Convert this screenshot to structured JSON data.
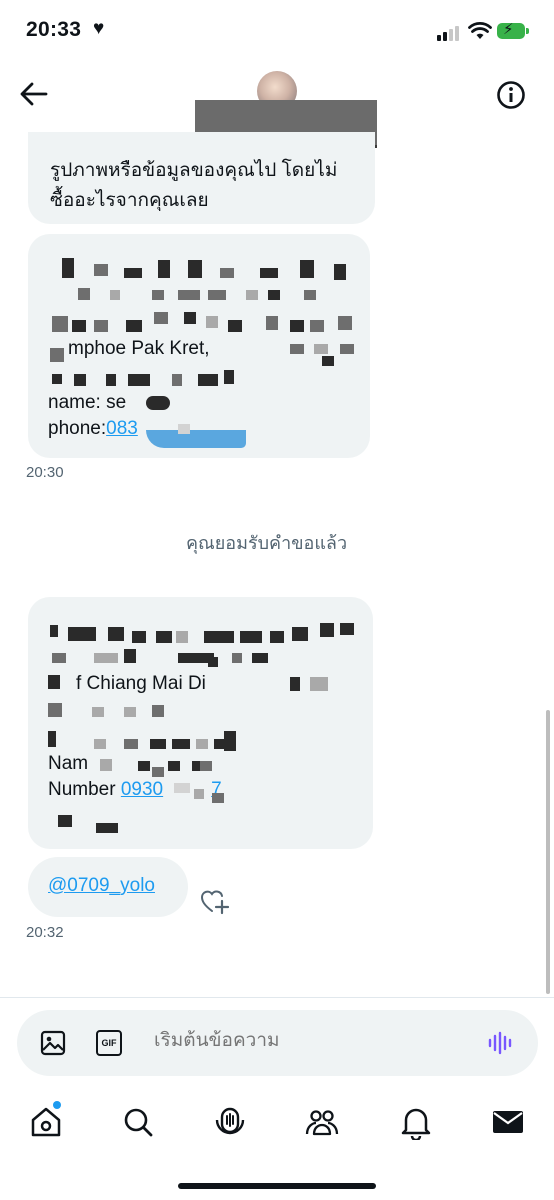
{
  "status_bar": {
    "time": "20:33",
    "heart": "♥",
    "battery_color": "#38b249"
  },
  "header": {
    "back_icon": "back-arrow-icon",
    "info_icon": "info-icon"
  },
  "messages": {
    "first_bubble_lines": [
      "รูปภาพหรือข้อมูลของคุณไป โดยไม่",
      "ซื้ออะไรจากคุณเลย"
    ],
    "second_bubble": {
      "line_amphoe": "mphoe Pak Kret,",
      "name_prefix": "name: se",
      "phone_prefix": "phone:",
      "phone_link": "083"
    },
    "time_1": "20:30",
    "system_message": "คุณยอมรับคำขอแล้ว",
    "third_bubble": {
      "line_chiang": "f Chiang Mai Di",
      "name_prefix": "Nam",
      "number_prefix": "Number ",
      "number_link_start": "0930",
      "number_link_end": "7"
    },
    "mention": "@0709_yolo",
    "time_2": "20:32"
  },
  "composer": {
    "placeholder": "เริ่มต้นข้อความ",
    "gif_label": "GIF"
  },
  "tabbar": {
    "items": [
      "home-icon",
      "search-icon",
      "spaces-icon",
      "communities-icon",
      "notifications-icon",
      "messages-icon"
    ]
  },
  "colors": {
    "accent": "#1d9bf0",
    "bubble": "#eff3f4",
    "text_secondary": "#536471"
  }
}
